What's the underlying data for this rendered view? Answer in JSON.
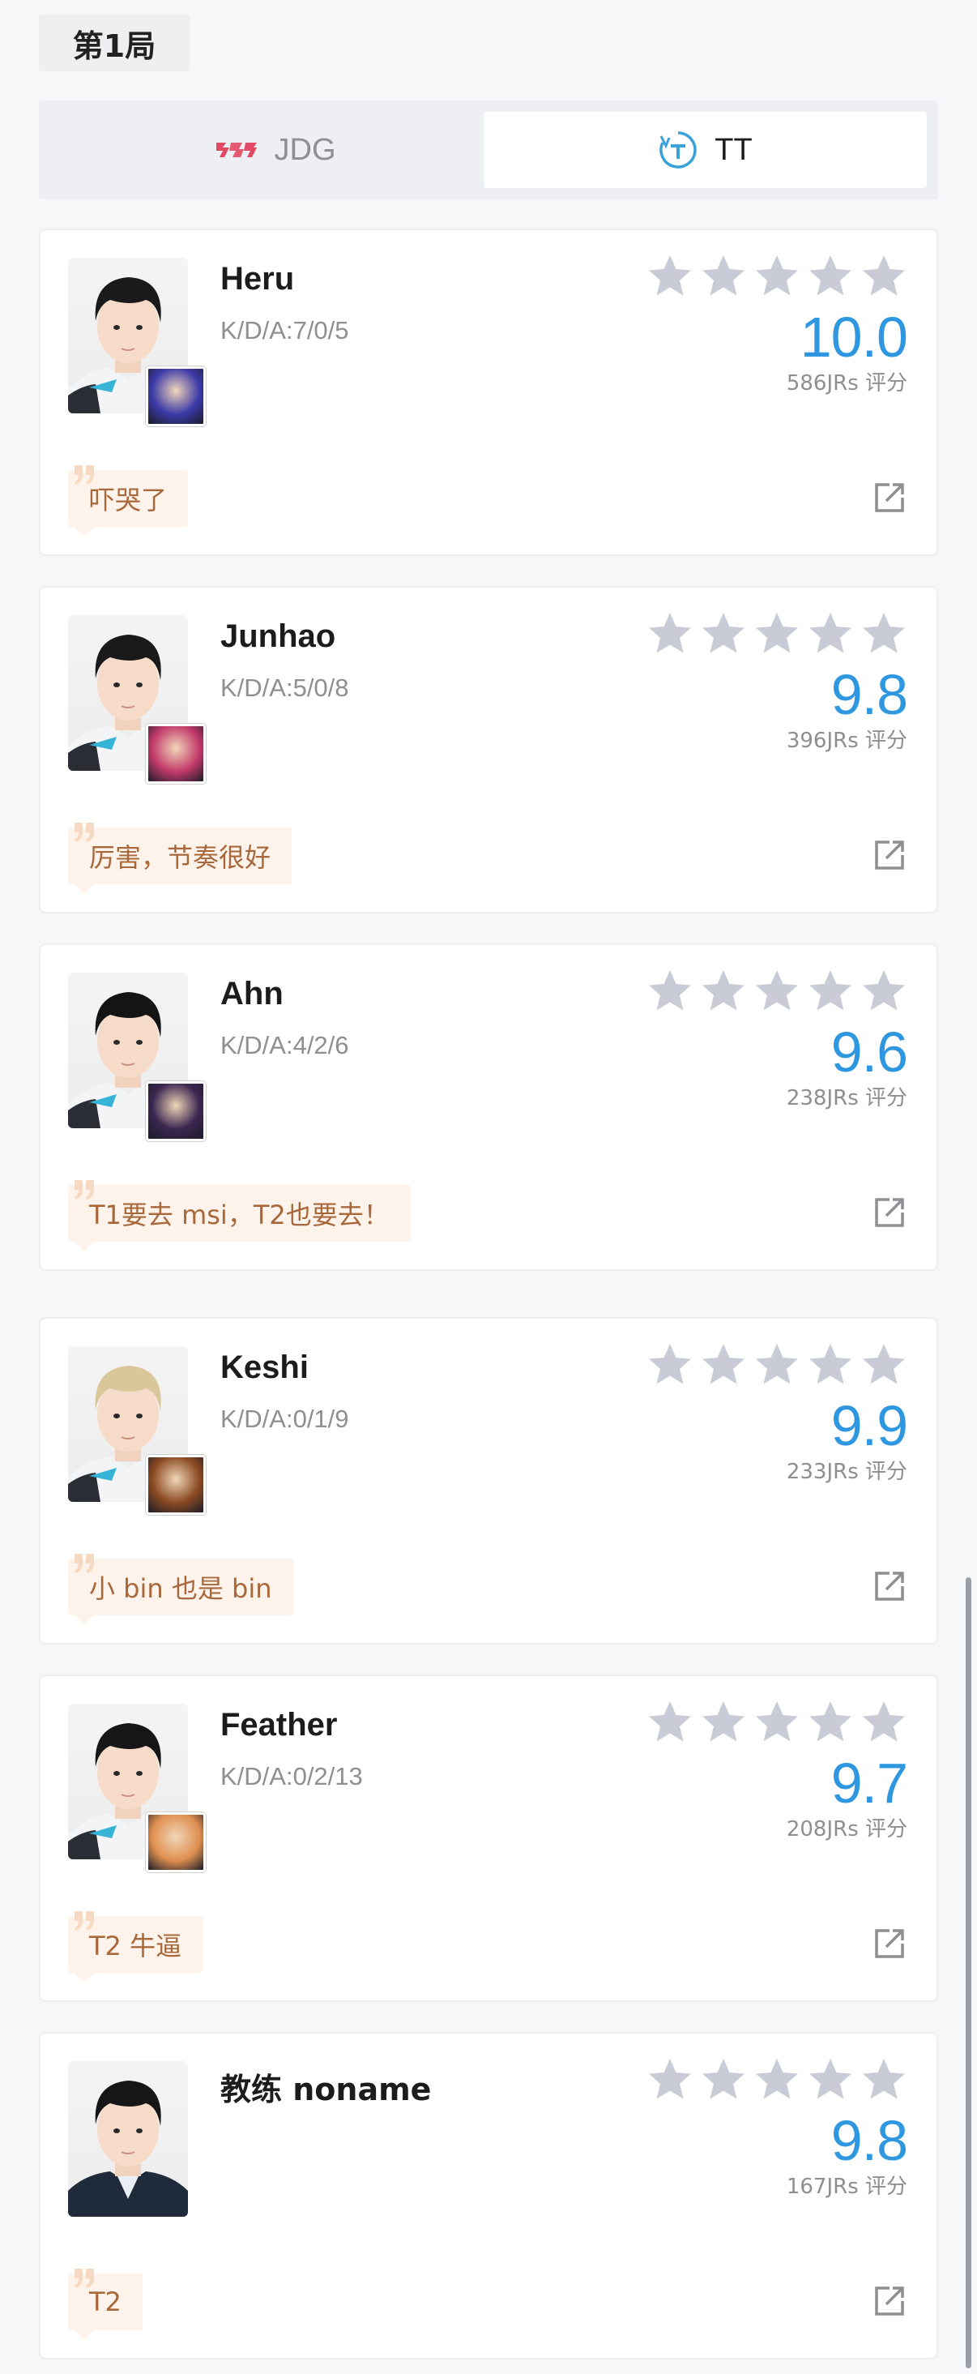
{
  "round": "第1局",
  "teams": [
    {
      "name": "JDG",
      "logo_icon": "jdg-logo-icon",
      "color": "#e04a64",
      "selected": false
    },
    {
      "name": "TT",
      "logo_icon": "tt-logo-icon",
      "color": "#3aa2d8",
      "selected": true
    }
  ],
  "players": [
    {
      "name": "Heru",
      "kda": "K/D/A:7/0/5",
      "rating": 5,
      "score": "10.0",
      "votes": "586JRs 评分",
      "comment": "吓哭了",
      "champion_color": "#3c3aa8",
      "hair": "#1a1a1a"
    },
    {
      "name": "Junhao",
      "kda": "K/D/A:5/0/8",
      "rating": 5,
      "score": "9.8",
      "votes": "396JRs 评分",
      "comment": "厉害，节奏很好",
      "champion_color": "#c23a6a",
      "hair": "#1a1a1a"
    },
    {
      "name": "Ahn",
      "kda": "K/D/A:4/2/6",
      "rating": 5,
      "score": "9.6",
      "votes": "238JRs 评分",
      "comment": "T1要去 msi，T2也要去！",
      "champion_color": "#3b2650",
      "hair": "#141414"
    },
    {
      "name": "Keshi",
      "kda": "K/D/A:0/1/9",
      "rating": 5,
      "score": "9.9",
      "votes": "233JRs 评分",
      "comment": "小 bin 也是 bin",
      "champion_color": "#8a4a22",
      "hair": "#d9c79a"
    },
    {
      "name": "Feather",
      "kda": "K/D/A:0/2/13",
      "rating": 5,
      "score": "9.7",
      "votes": "208JRs 评分",
      "comment": "T2 牛逼",
      "champion_color": "#e09050",
      "hair": "#161616"
    },
    {
      "name": "教练 noname",
      "kda": "",
      "rating": 5,
      "score": "9.8",
      "votes": "167JRs 评分",
      "comment": "T2",
      "champion_color": "",
      "hair": "#161616"
    }
  ],
  "colors": {
    "accent_score": "#2f96e0",
    "star_empty": "#c9ccd6",
    "comment_bg": "#fdf3ea",
    "comment_text": "#a8683c"
  }
}
